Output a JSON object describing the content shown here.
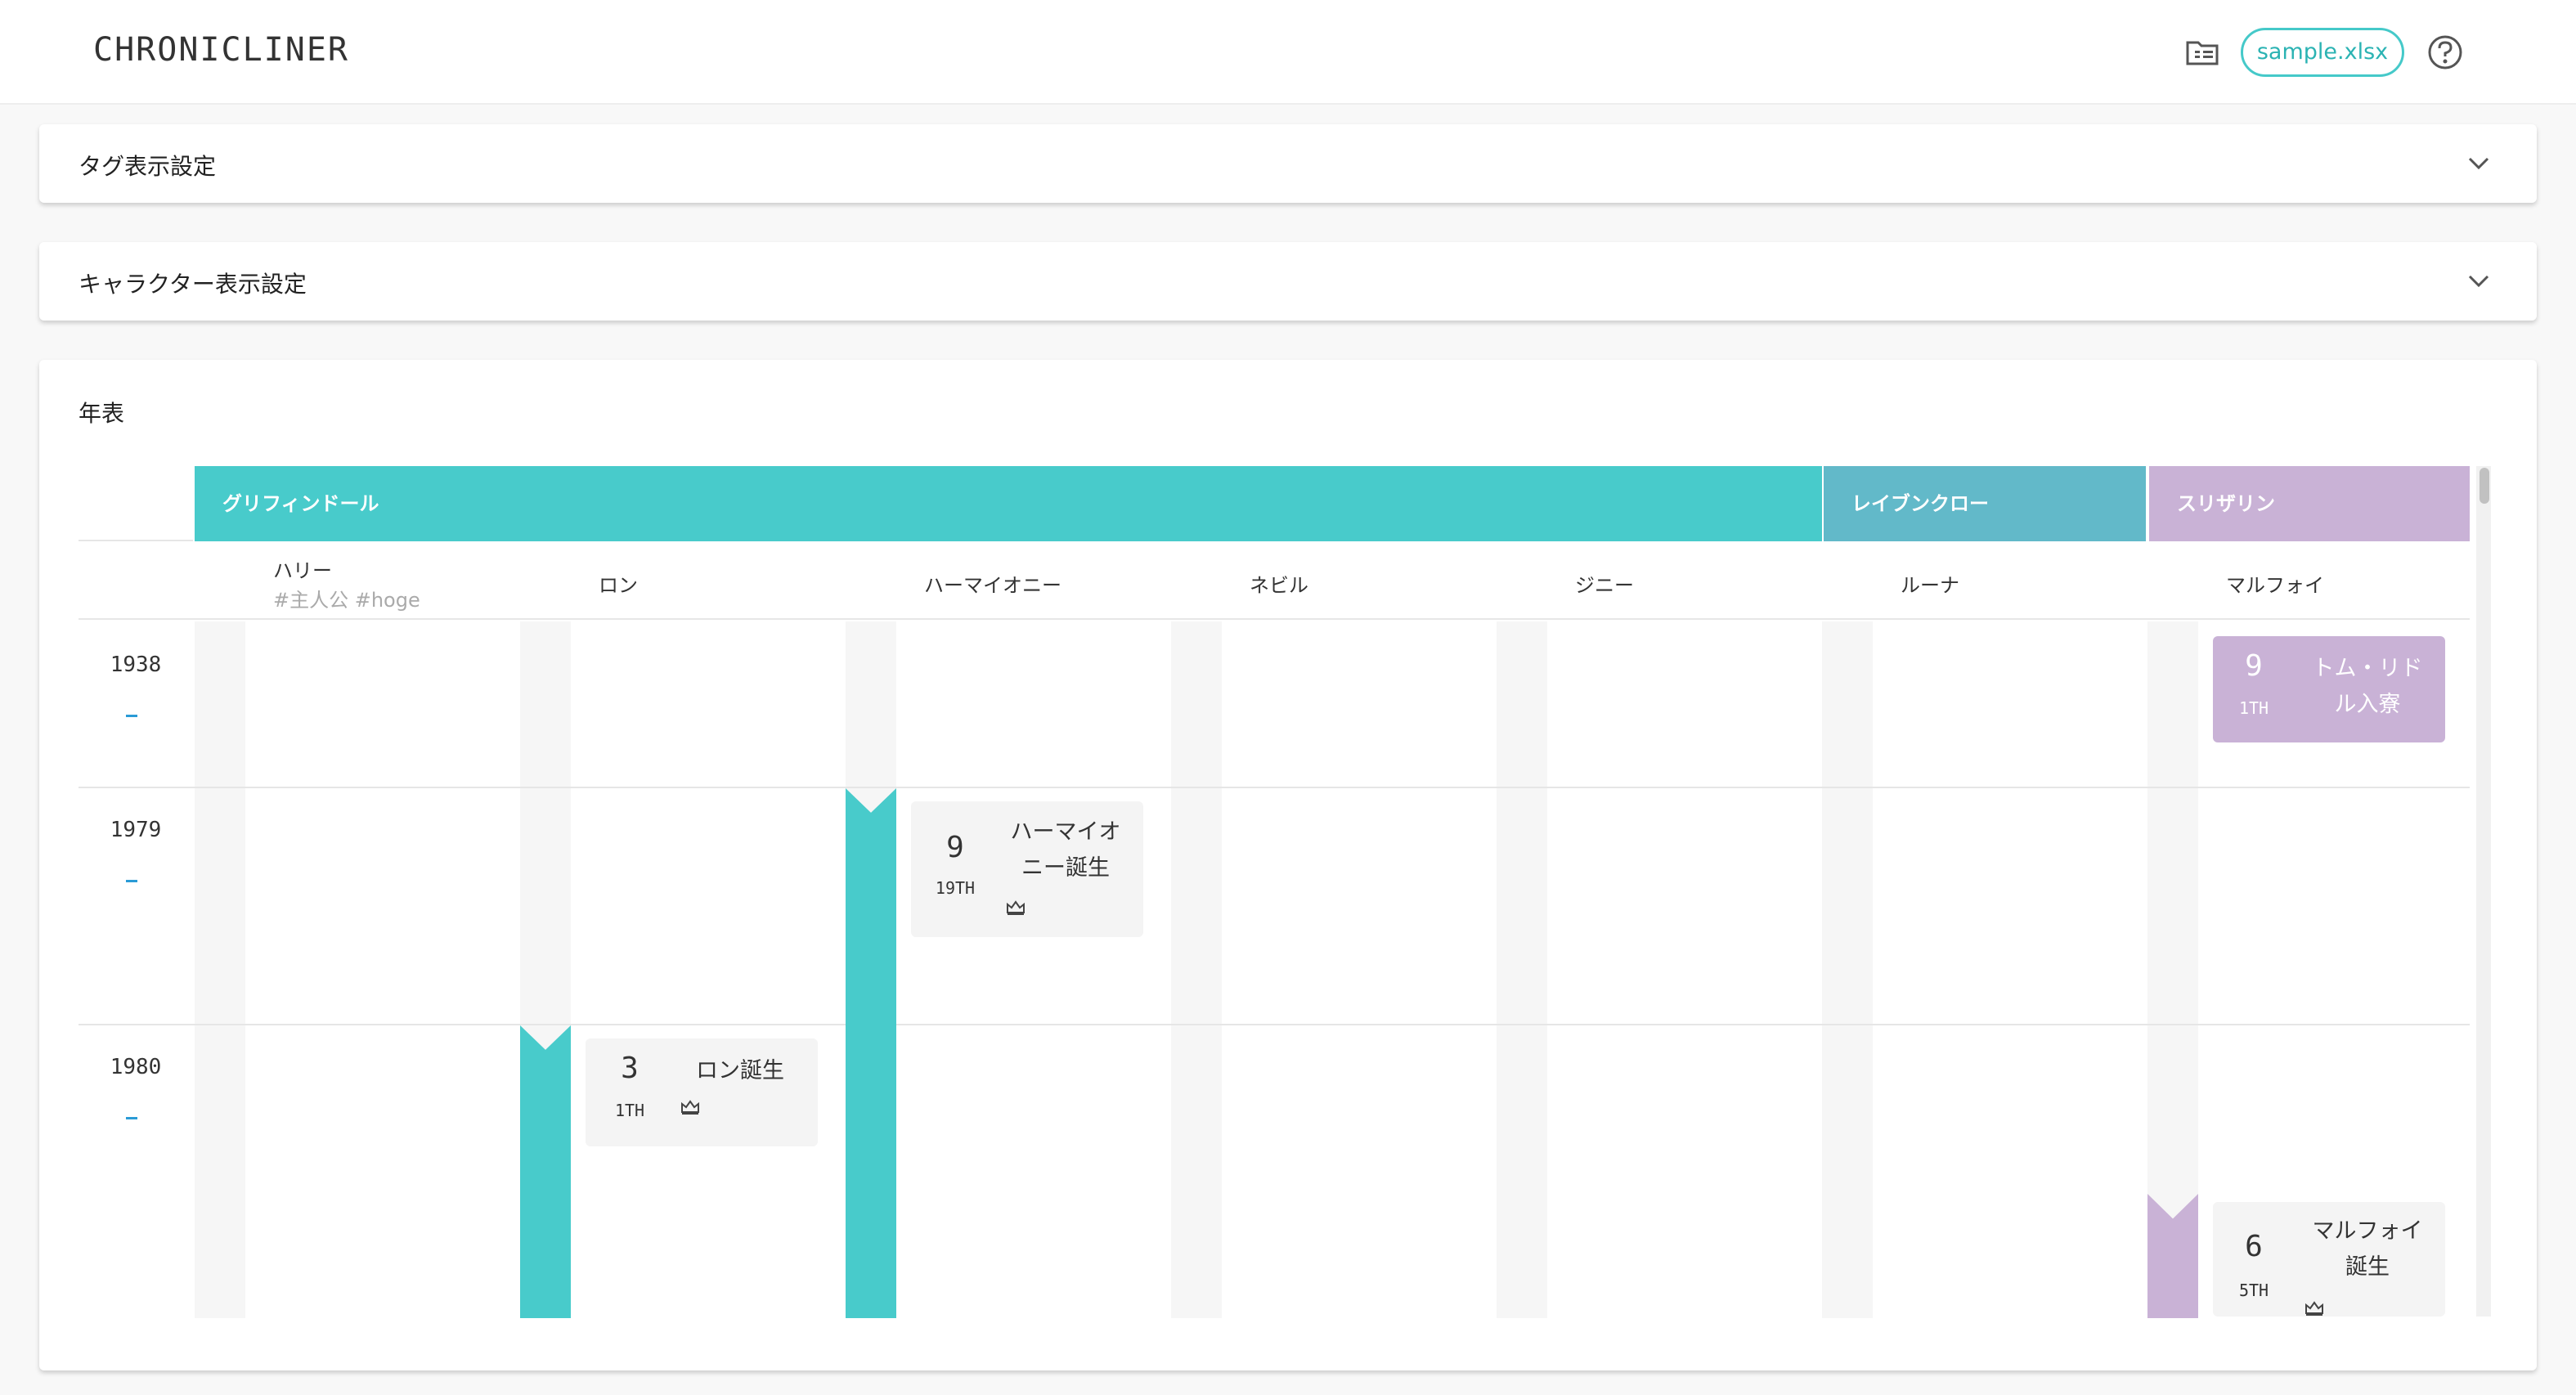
{
  "app": {
    "logo": "CHRONICLINER",
    "file_name": "sample.xlsx",
    "icons": [
      "folder-icon",
      "help-icon"
    ]
  },
  "panels": {
    "tag_settings": "タグ表示設定",
    "character_settings": "キャラクター表示設定",
    "timeline_title": "年表"
  },
  "colors": {
    "gryffindor": "#48cbcb",
    "ravenclaw": "#62b9c9",
    "slytherin": "#c9b2d6",
    "accent": "#45c9c9"
  },
  "groups": [
    {
      "name": "グリフィンドール"
    },
    {
      "name": "レイブンクロー"
    },
    {
      "name": "スリザリン"
    }
  ],
  "characters": [
    {
      "name": "ハリー",
      "tags": "#主人公 #hoge"
    },
    {
      "name": "ロン"
    },
    {
      "name": "ハーマイオニー"
    },
    {
      "name": "ネビル"
    },
    {
      "name": "ジニー"
    },
    {
      "name": "ルーナ"
    },
    {
      "name": "マルフォイ"
    }
  ],
  "years": [
    {
      "year": "1938"
    },
    {
      "year": "1979"
    },
    {
      "year": "1980"
    }
  ],
  "events": [
    {
      "month": "9",
      "day": "1TH",
      "text_line1": "トム・リド",
      "text_line2": "ル入寮"
    },
    {
      "month": "9",
      "day": "19TH",
      "text_line1": "ハーマイオ",
      "text_line2": "ニー誕生"
    },
    {
      "month": "3",
      "day": "1TH",
      "text_line1": "ロン誕生",
      "text_line2": ""
    },
    {
      "month": "6",
      "day": "5TH",
      "text_line1": "マルフォイ",
      "text_line2": "誕生"
    }
  ]
}
